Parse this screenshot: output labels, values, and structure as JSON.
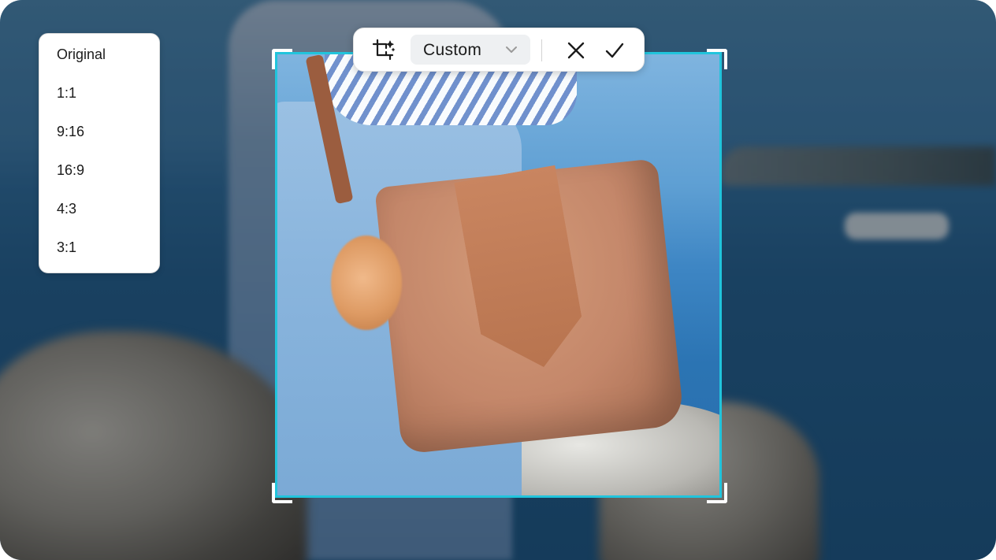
{
  "ratio_menu": {
    "items": [
      {
        "label": "Original"
      },
      {
        "label": "1:1"
      },
      {
        "label": "9:16"
      },
      {
        "label": "16:9"
      },
      {
        "label": "4:3"
      },
      {
        "label": "3:1"
      }
    ]
  },
  "toolbar": {
    "aspect_select": {
      "selected": "Custom"
    },
    "icons": [
      "crop-magic-icon",
      "chevron-down-icon",
      "close-icon",
      "checkmark-icon"
    ]
  },
  "colors": {
    "crop_border": "#21c4dc",
    "handle": "#ffffff"
  }
}
